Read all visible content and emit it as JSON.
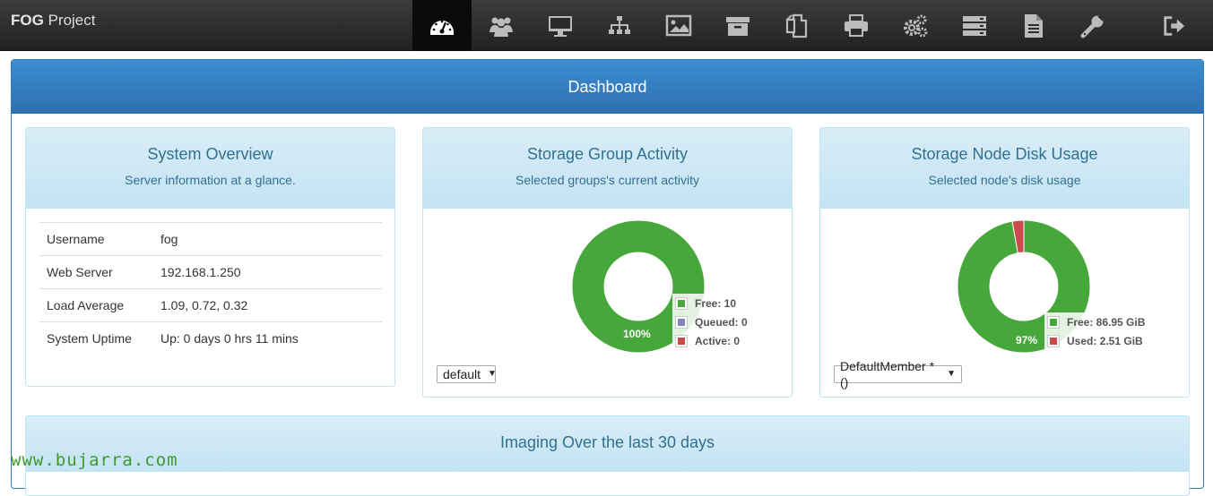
{
  "brand": {
    "strong": "FOG",
    "rest": " Project"
  },
  "nav": {
    "items": [
      "dashboard-icon",
      "users-icon",
      "monitor-icon",
      "sitemap-icon",
      "image-icon",
      "archive-icon",
      "copy-icon",
      "print-icon",
      "cogs-icon",
      "server-icon",
      "file-icon",
      "wrench-icon"
    ],
    "logout_icon": "sign-out-icon"
  },
  "dashboard": {
    "title": "Dashboard"
  },
  "system_overview": {
    "title": "System Overview",
    "subtitle": "Server information at a glance.",
    "rows": [
      {
        "key": "Username",
        "value": "fog"
      },
      {
        "key": "Web Server",
        "value": "192.168.1.250"
      },
      {
        "key": "Load Average",
        "value": "1.09, 0.72, 0.32"
      },
      {
        "key": "System Uptime",
        "value": "Up: 0 days 0 hrs 11 mins"
      }
    ]
  },
  "storage_group": {
    "title": "Storage Group Activity",
    "subtitle": "Selected groups's current activity",
    "selected": "default",
    "percent_label": "100%",
    "legend": [
      {
        "label": "Free: 10",
        "color": "#46a83b"
      },
      {
        "label": "Queued: 0",
        "color": "#7f86b8"
      },
      {
        "label": "Active: 0",
        "color": "#cb4b4b"
      }
    ]
  },
  "storage_node": {
    "title": "Storage Node Disk Usage",
    "subtitle": "Selected node's disk usage",
    "selected": "DefaultMember * ()",
    "percent_label": "97%",
    "legend": [
      {
        "label": "Free: 86.95 GiB",
        "color": "#46a83b"
      },
      {
        "label": "Used: 2.51 GiB",
        "color": "#cb4b4b"
      }
    ]
  },
  "chart_data": [
    {
      "type": "pie",
      "title": "Storage Group Activity",
      "categories": [
        "Free",
        "Queued",
        "Active"
      ],
      "values": [
        10,
        0,
        0
      ]
    },
    {
      "type": "pie",
      "title": "Storage Node Disk Usage",
      "categories": [
        "Free",
        "Used"
      ],
      "values": [
        86.95,
        2.51
      ]
    }
  ],
  "imaging": {
    "title": "Imaging Over the last 30 days"
  },
  "watermark": "www.bujarra.com"
}
